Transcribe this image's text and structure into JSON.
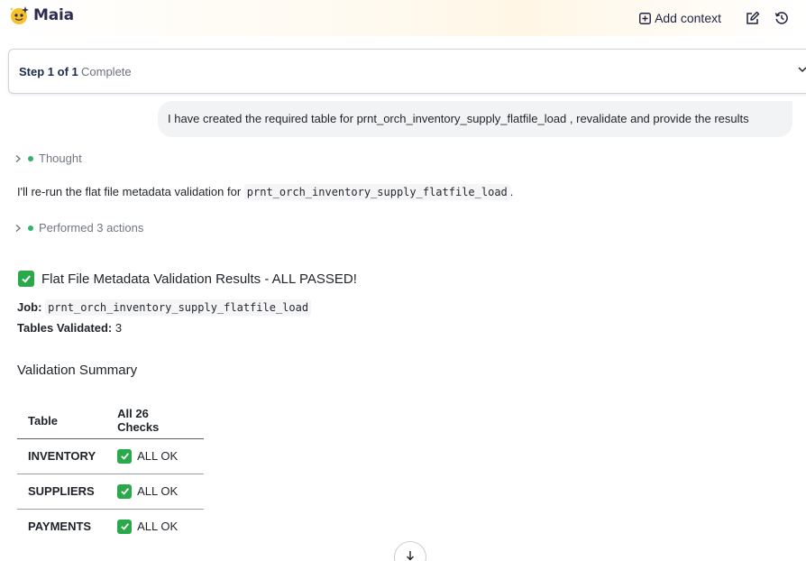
{
  "app": {
    "name": "Maia"
  },
  "header": {
    "add_context_label": "Add context"
  },
  "step": {
    "label": "Step 1 of 1",
    "status": "Complete"
  },
  "user_message": "I have created the required table for prnt_orch_inventory_supply_flatfile_load , revalidate and provide the results",
  "thought_label": "Thought",
  "intro": {
    "text": "I'll re-run the flat file metadata validation for ",
    "code": "prnt_orch_inventory_supply_flatfile_load",
    "suffix": "."
  },
  "actions_label": "Performed 3 actions",
  "result": {
    "title": "Flat File Metadata Validation Results - ALL PASSED!",
    "job_label": "Job:",
    "job_value": "prnt_orch_inventory_supply_flatfile_load",
    "tables_label": "Tables Validated:",
    "tables_value": "3"
  },
  "summary": {
    "heading": "Validation Summary",
    "columns": [
      "Table",
      "All 26 Checks"
    ],
    "rows": [
      {
        "table": "INVENTORY",
        "status": "ALL OK"
      },
      {
        "table": "SUPPLIERS",
        "status": "ALL OK"
      },
      {
        "table": "PAYMENTS",
        "status": "ALL OK"
      }
    ]
  },
  "colors": {
    "accent_green": "#2fb36f",
    "check_green": "#2aa84a",
    "logo_yellow": "#f6c12b",
    "brand_navy": "#2d2b52"
  },
  "icons": [
    "maia-logo-icon",
    "add-context-icon",
    "edit-icon",
    "history-icon",
    "chevron-down-icon",
    "chevron-right-icon",
    "check-icon",
    "arrow-down-icon"
  ]
}
